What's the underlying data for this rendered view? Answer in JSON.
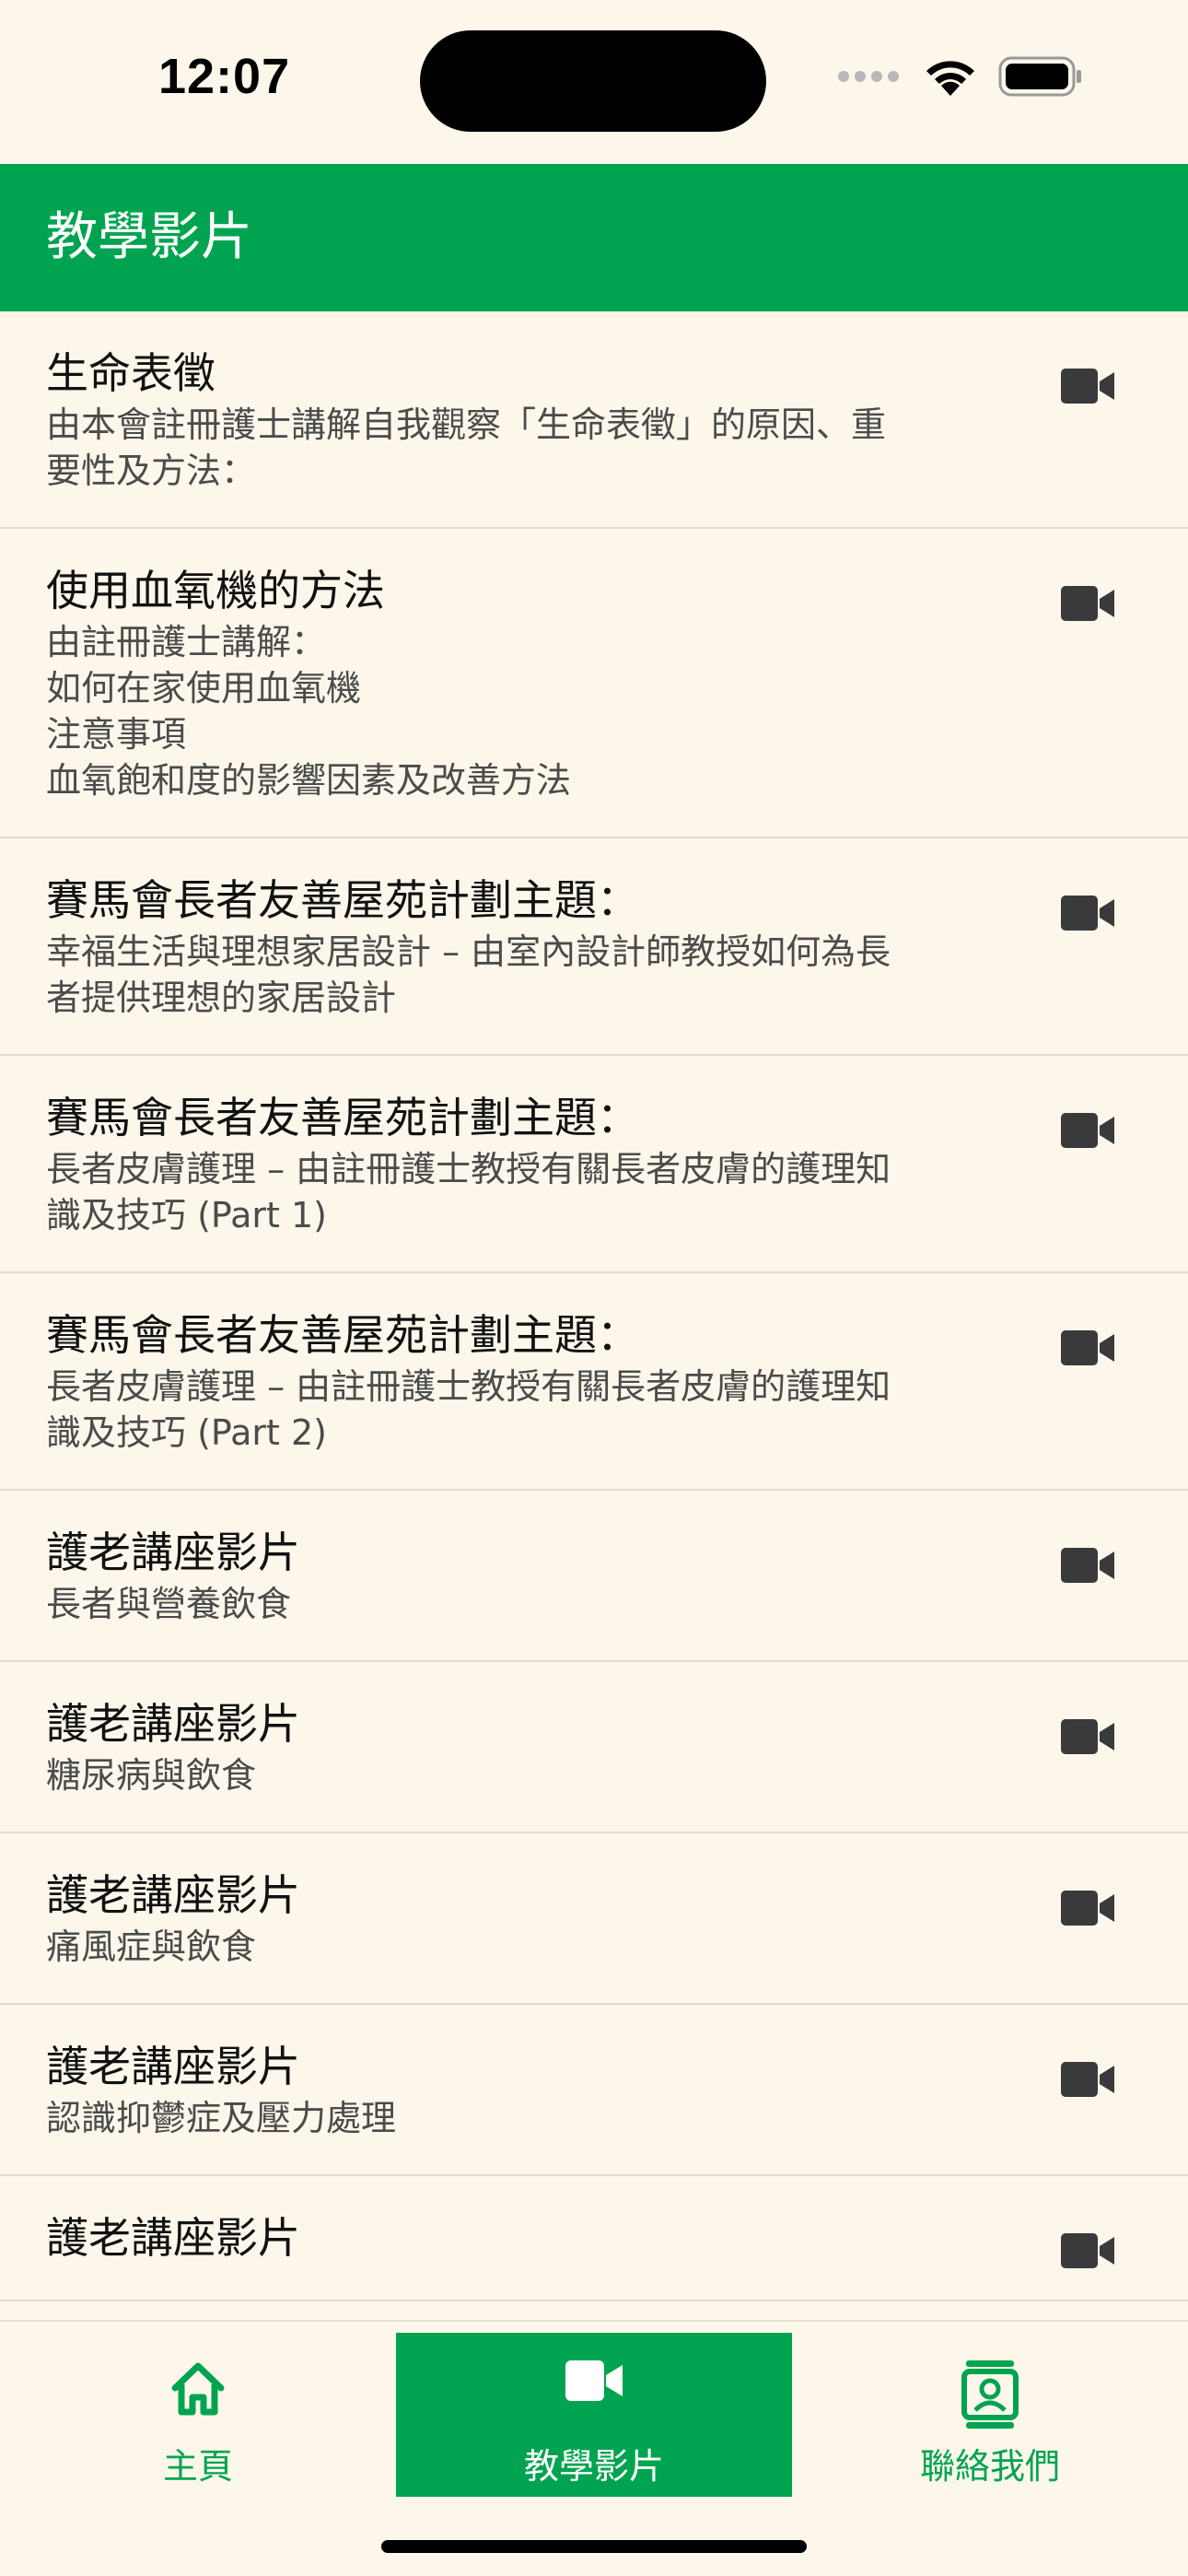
{
  "status_bar": {
    "time": "12:07"
  },
  "header": {
    "title": "教學影片"
  },
  "colors": {
    "accent": "#00a450",
    "background": "#fcf7ea",
    "icon": "#3a3a3c"
  },
  "videos": [
    {
      "title": "生命表徵",
      "description": "由本會註冊護士講解自我觀察「生命表徵」的原因、重\n要性及方法：",
      "icon": "video-camera-icon"
    },
    {
      "title": "使用血氧機的方法",
      "description": "由註冊護士講解：\n如何在家使用血氧機\n注意事項\n血氧飽和度的影響因素及改善方法",
      "icon": "video-camera-icon"
    },
    {
      "title": "賽馬會長者友善屋苑計劃主題：",
      "description": "幸福生活與理想家居設計 – 由室內設計師教授如何為長\n者提供理想的家居設計",
      "icon": "video-camera-icon"
    },
    {
      "title": "賽馬會長者友善屋苑計劃主題：",
      "description": "長者皮膚護理 – 由註冊護士教授有關長者皮膚的護理知\n識及技巧 (Part 1)",
      "icon": "video-camera-icon"
    },
    {
      "title": "賽馬會長者友善屋苑計劃主題：",
      "description": "長者皮膚護理 – 由註冊護士教授有關長者皮膚的護理知\n識及技巧 (Part 2)",
      "icon": "video-camera-icon"
    },
    {
      "title": "護老講座影片",
      "description": "長者與營養飲食",
      "icon": "video-camera-icon"
    },
    {
      "title": "護老講座影片",
      "description": "糖尿病與飲食",
      "icon": "video-camera-icon"
    },
    {
      "title": "護老講座影片",
      "description": "痛風症與飲食",
      "icon": "video-camera-icon"
    },
    {
      "title": "護老講座影片",
      "description": "認識抑鬱症及壓力處理",
      "icon": "video-camera-icon"
    },
    {
      "title": "護老講座影片",
      "description": "",
      "icon": "video-camera-icon"
    }
  ],
  "tabs": [
    {
      "label": "主頁",
      "icon": "home-icon",
      "active": false
    },
    {
      "label": "教學影片",
      "icon": "video-camera-icon",
      "active": true
    },
    {
      "label": "聯絡我們",
      "icon": "contacts-icon",
      "active": false
    }
  ]
}
